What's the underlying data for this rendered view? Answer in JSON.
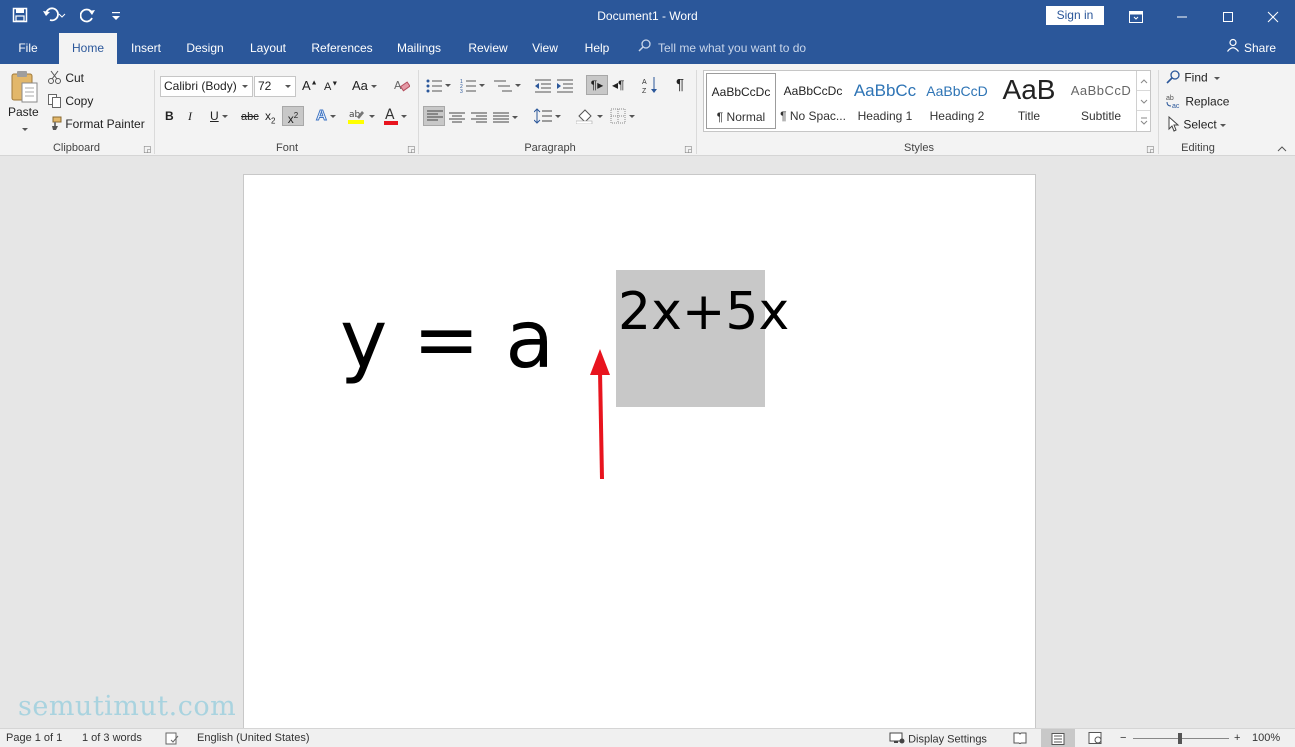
{
  "window": {
    "title": "Document1  -  Word",
    "signin_label": "Sign in"
  },
  "tabs": {
    "file": "File",
    "home": "Home",
    "insert": "Insert",
    "design": "Design",
    "layout": "Layout",
    "references": "References",
    "mailings": "Mailings",
    "review": "Review",
    "view": "View",
    "help": "Help",
    "tell_me": "Tell me what you want to do",
    "share": "Share"
  },
  "clipboard": {
    "paste": "Paste",
    "cut": "Cut",
    "copy": "Copy",
    "format_painter": "Format Painter",
    "label": "Clipboard"
  },
  "font": {
    "name": "Calibri (Body)",
    "size": "72",
    "label": "Font",
    "case_label": "Aa"
  },
  "paragraph": {
    "label": "Paragraph"
  },
  "styles": {
    "label": "Styles",
    "items": [
      {
        "preview": "AaBbCcDc",
        "label": "¶ Normal"
      },
      {
        "preview": "AaBbCcDc",
        "label": "¶ No Spac..."
      },
      {
        "preview": "AaBbCc",
        "label": "Heading 1"
      },
      {
        "preview": "AaBbCcD",
        "label": "Heading 2"
      },
      {
        "preview": "AaB",
        "label": "Title"
      },
      {
        "preview": "AaBbCcD",
        "label": "Subtitle"
      }
    ]
  },
  "editing": {
    "find": "Find",
    "replace": "Replace",
    "select": "Select",
    "label": "Editing"
  },
  "document": {
    "base_text": "y = a",
    "superscript_text": "2x+5x"
  },
  "watermark": "semutimut.com",
  "status": {
    "page": "Page 1 of 1",
    "words": "1 of 3 words",
    "language": "English (United States)",
    "display_settings": "Display Settings",
    "zoom": "100%"
  },
  "colors": {
    "accent": "#2b579a",
    "highlight": "#c8c8c8",
    "arrow": "#e8141e",
    "watermark": "#a9d3df"
  }
}
